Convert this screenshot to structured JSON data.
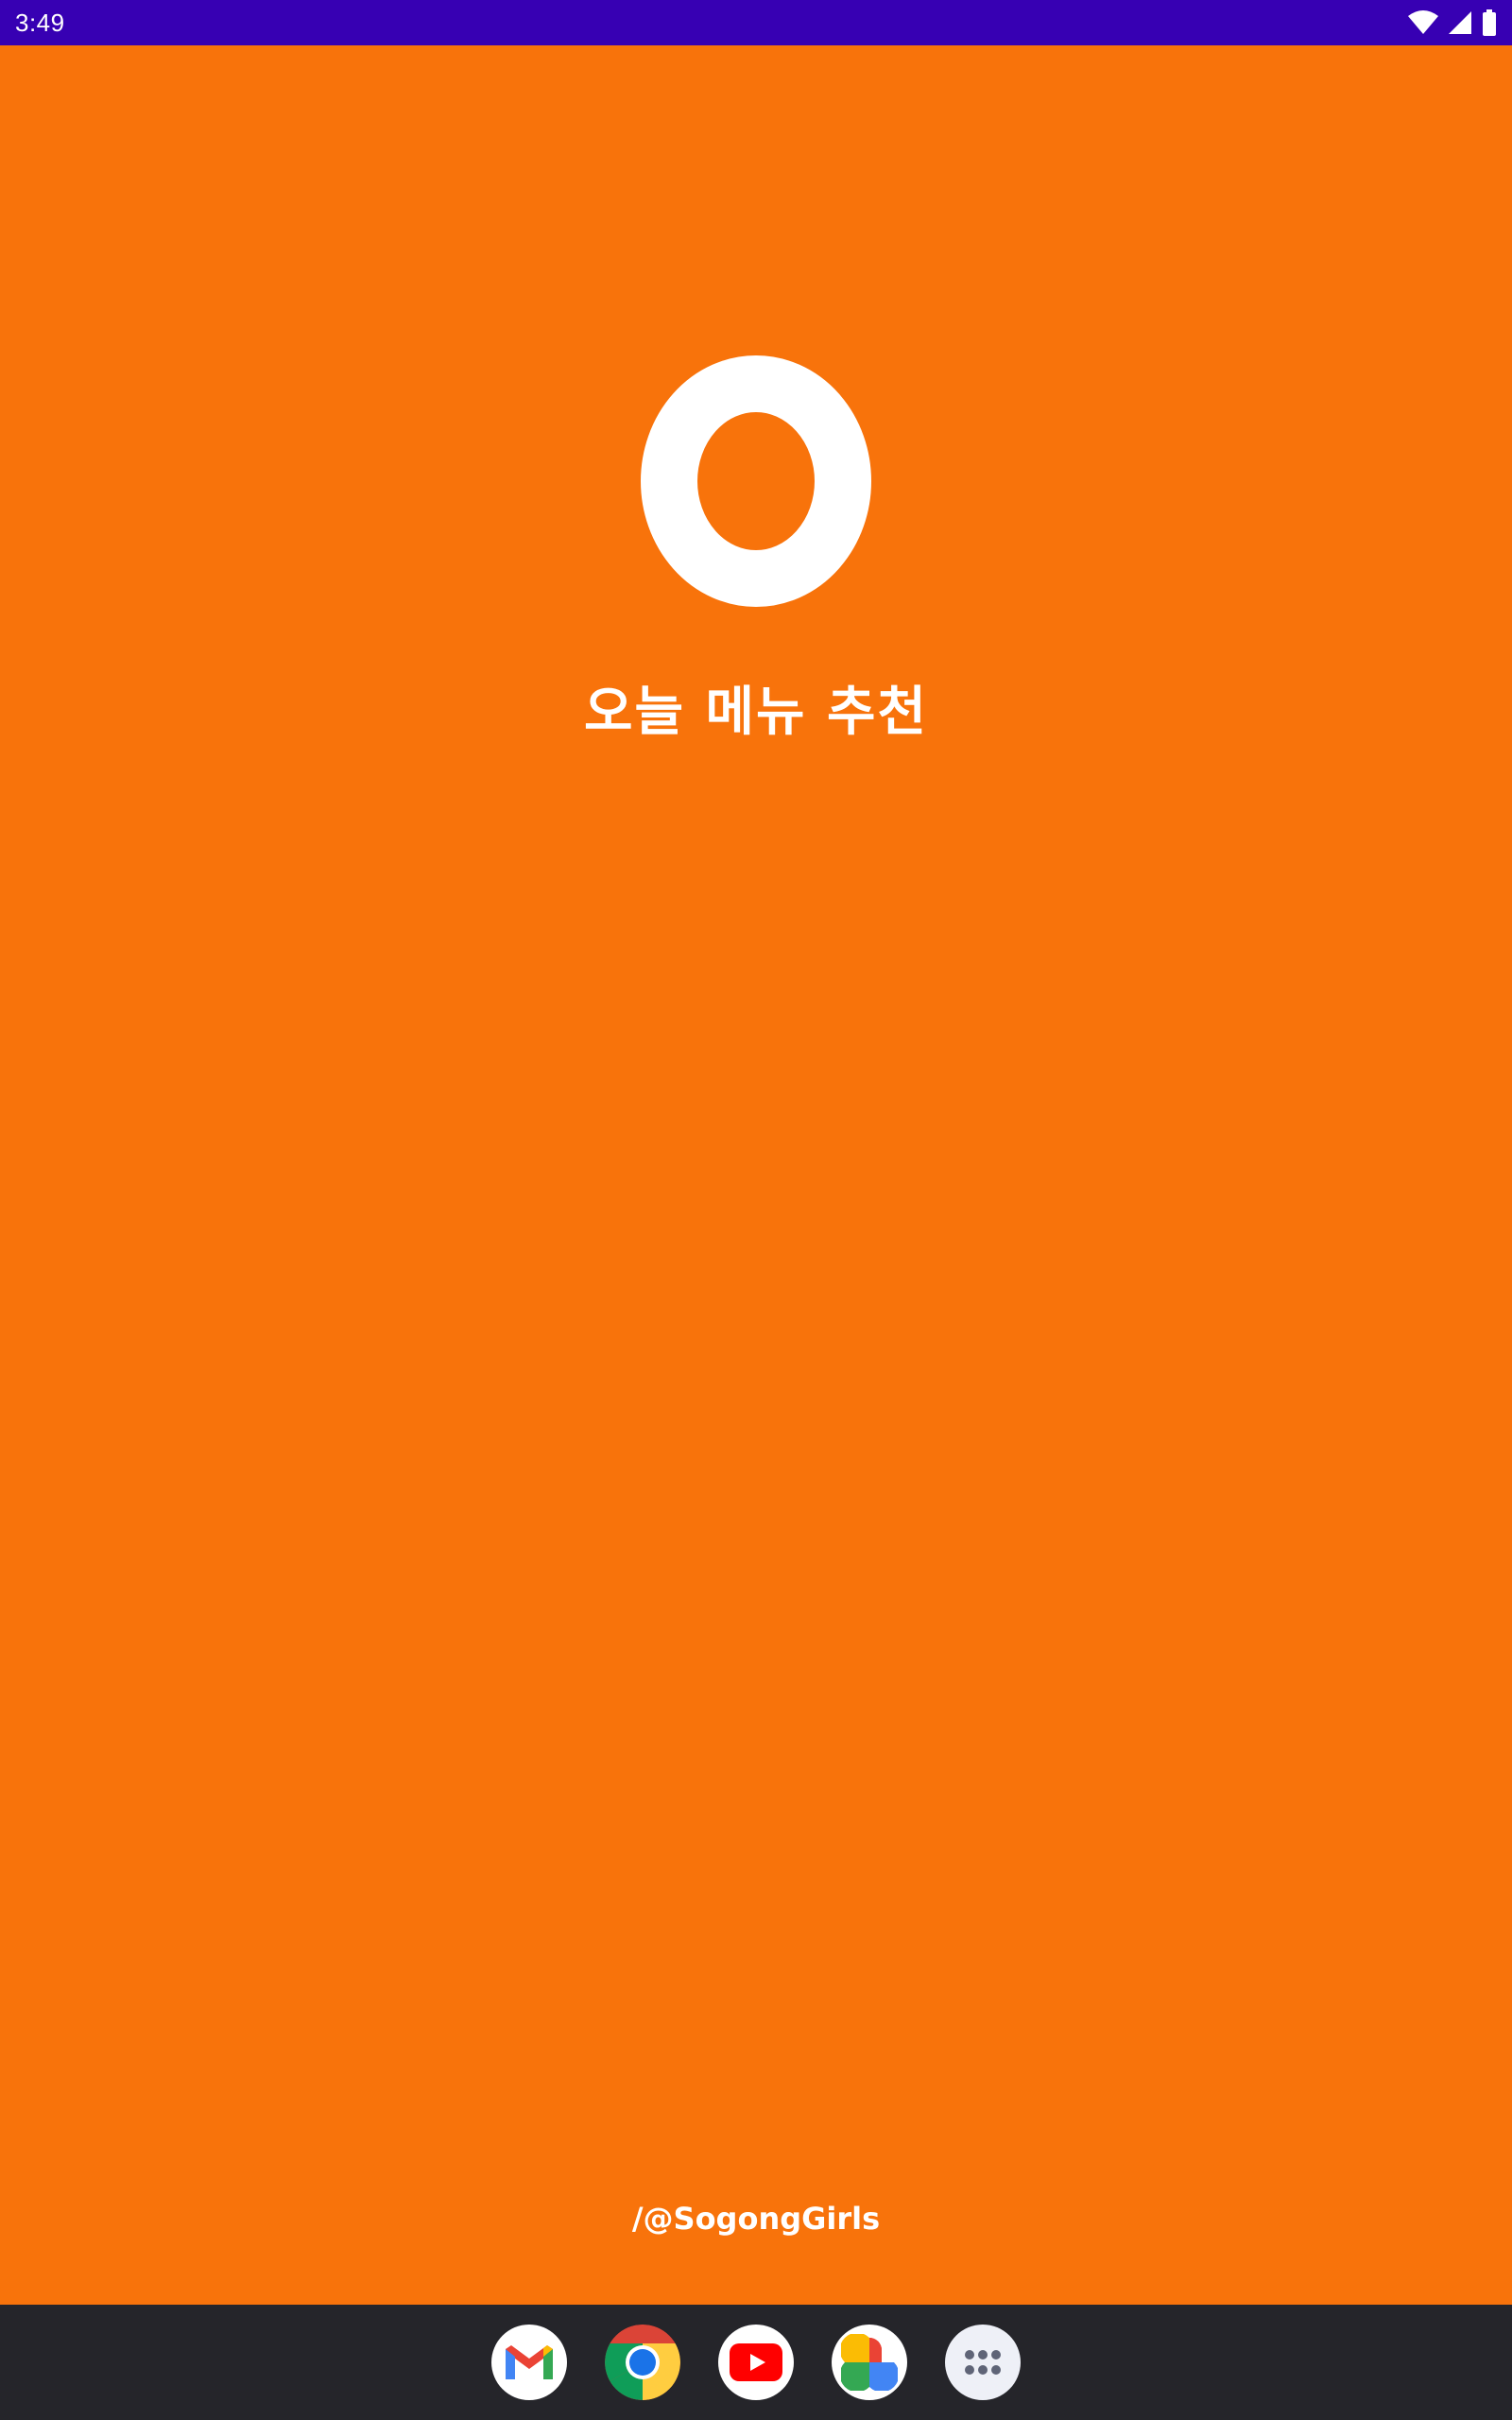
{
  "status_bar": {
    "time": "3:49",
    "background": "#3700B3",
    "icons": [
      "wifi-icon",
      "cellular-signal-icon",
      "battery-icon"
    ]
  },
  "splash": {
    "background": "#F8730B",
    "logo_icon": "o-logo-icon",
    "title": "오늘 메뉴 추천",
    "credit": "/@SogongGirls"
  },
  "dock": {
    "background": "#25252A",
    "apps": [
      {
        "name": "Gmail",
        "icon": "gmail-icon"
      },
      {
        "name": "Chrome",
        "icon": "chrome-icon"
      },
      {
        "name": "YouTube",
        "icon": "youtube-icon"
      },
      {
        "name": "Photos",
        "icon": "photos-icon"
      },
      {
        "name": "All apps",
        "icon": "app-drawer-icon"
      }
    ]
  }
}
